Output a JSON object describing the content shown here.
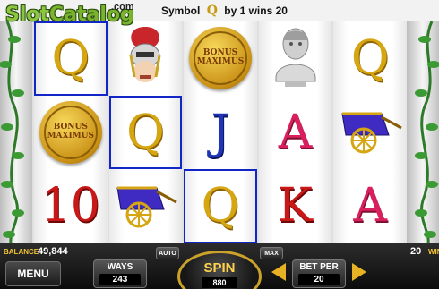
{
  "header": {
    "logo_slot": "Slot",
    "logo_catalog": "Catalog",
    "logo_com": ".com",
    "win_prefix": "Symbol",
    "win_symbol": "Q",
    "win_suffix": "by 1 wins 20"
  },
  "reels": [
    [
      {
        "type": "letter",
        "text": "Q",
        "color": "gold",
        "win": true
      },
      {
        "type": "coin",
        "text": [
          "BONUS",
          "MAXIMUS"
        ],
        "win": false
      },
      {
        "type": "letter",
        "text": "10",
        "color": "red",
        "win": false
      }
    ],
    [
      {
        "type": "icon",
        "icon": "roman-soldier-icon",
        "win": false
      },
      {
        "type": "letter",
        "text": "Q",
        "color": "gold",
        "win": true
      },
      {
        "type": "icon",
        "icon": "chariot-icon",
        "win": false
      }
    ],
    [
      {
        "type": "coin",
        "text": [
          "BONUS",
          "MAXIMUS"
        ],
        "win": false
      },
      {
        "type": "letter",
        "text": "J",
        "color": "blue",
        "win": false
      },
      {
        "type": "letter",
        "text": "Q",
        "color": "gold",
        "win": true
      }
    ],
    [
      {
        "type": "icon",
        "icon": "statue-bust-icon",
        "win": false
      },
      {
        "type": "letter",
        "text": "A",
        "color": "pink",
        "win": false
      },
      {
        "type": "letter",
        "text": "K",
        "color": "red",
        "win": false
      }
    ],
    [
      {
        "type": "letter",
        "text": "Q",
        "color": "gold",
        "win": false
      },
      {
        "type": "icon",
        "icon": "chariot-icon",
        "win": false
      },
      {
        "type": "letter",
        "text": "A",
        "color": "pink",
        "win": false
      }
    ]
  ],
  "footer": {
    "balance_label": "BALANCE",
    "balance_value": "49,844",
    "menu_label": "MENU",
    "ways_label": "WAYS",
    "ways_value": "243",
    "auto_label": "AUTO",
    "max_label": "MAX",
    "spin_label": "SPIN",
    "spin_value": "880",
    "bet_label": "BET PER",
    "bet_value": "20",
    "win_value": "20",
    "win_label": "WIN"
  },
  "colors": {
    "gold": "#d6a512",
    "win_border": "#1226c8",
    "accent": "#f2c431"
  }
}
